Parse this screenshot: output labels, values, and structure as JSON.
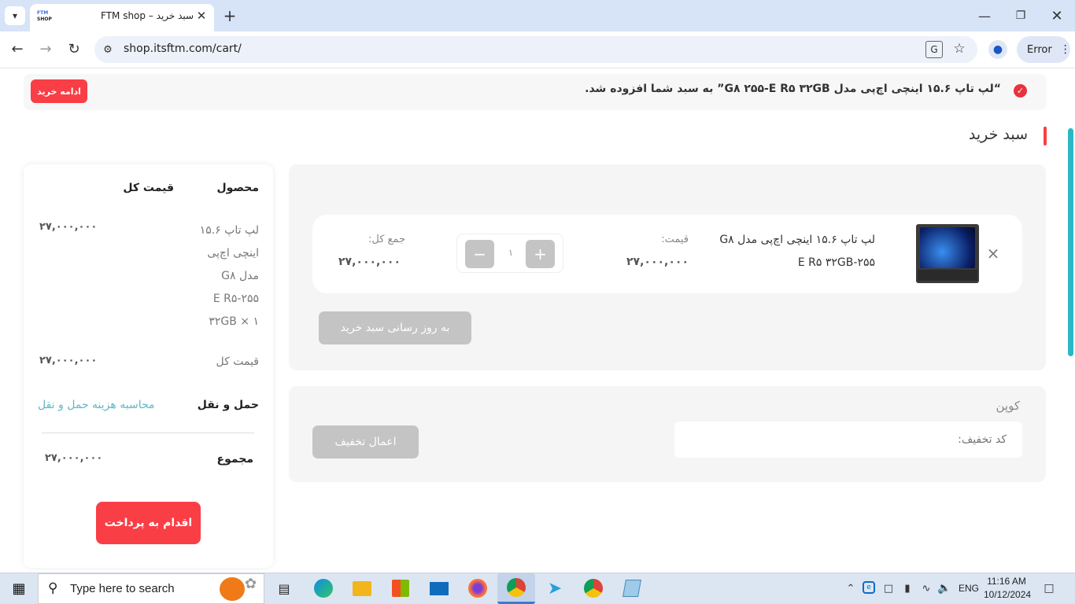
{
  "browser": {
    "tab_title": "FTM shop – سبد خرید",
    "url": "shop.itsftm.com/cart/",
    "profile_label": "Error",
    "logo_top": "FTM",
    "logo_bottom": "SHOP"
  },
  "notice": {
    "message": "“لپ تاپ ۱۵.۶ اینچی اچ‌پی مدل G۸ ۲۵۵-E R۵ ۳۲GB” به سبد شما افزوده شد.",
    "continue_label": "ادامه خرید"
  },
  "page": {
    "title": "سبد خرید"
  },
  "cart_item": {
    "name_line1": "لپ تاپ ۱۵.۶ اینچی اچ‌پی مدل  G۸",
    "name_line2": "۲۵۵-E R۵ ۳۲GB",
    "price_label": "قیمت:",
    "price": "۲۷,۰۰۰,۰۰۰",
    "quantity": "۱",
    "subtotal_label": "جمع کل:",
    "subtotal": "۲۷,۰۰۰,۰۰۰",
    "remove_symbol": "×",
    "plus_symbol": "+",
    "minus_symbol": "−"
  },
  "update_cart_label": "به روز رسانی سبد خرید",
  "coupon": {
    "title": "کوپن",
    "placeholder": "کد تخفیف:",
    "apply_label": "اعمال تخفیف"
  },
  "summary": {
    "product_header": "محصول",
    "total_header": "قیمت کل",
    "product_lines": [
      "لپ تاپ ۱۵.۶",
      "اینچی اچ‌پی",
      "مدل G۸",
      "۲۵۵-E R۵",
      "۳۲GB  × ۱"
    ],
    "product_total": "۲۷,۰۰۰,۰۰۰",
    "subtotal_label": "قیمت کل",
    "subtotal": "۲۷,۰۰۰,۰۰۰",
    "shipping_label": "حمل و نقل",
    "shipping_link": "محاسبه هزینه حمل و نقل",
    "total_label": "مجموع",
    "total": "۲۷,۰۰۰,۰۰۰",
    "checkout_label": "اقدام به پرداخت"
  },
  "taskbar": {
    "search_placeholder": "Type here to search",
    "language": "ENG",
    "time": "11:16 AM",
    "date": "10/12/2024"
  },
  "colors": {
    "accent_red": "#fa3e46",
    "link_teal": "#5fb8c7",
    "success_red": "#e8333d"
  }
}
